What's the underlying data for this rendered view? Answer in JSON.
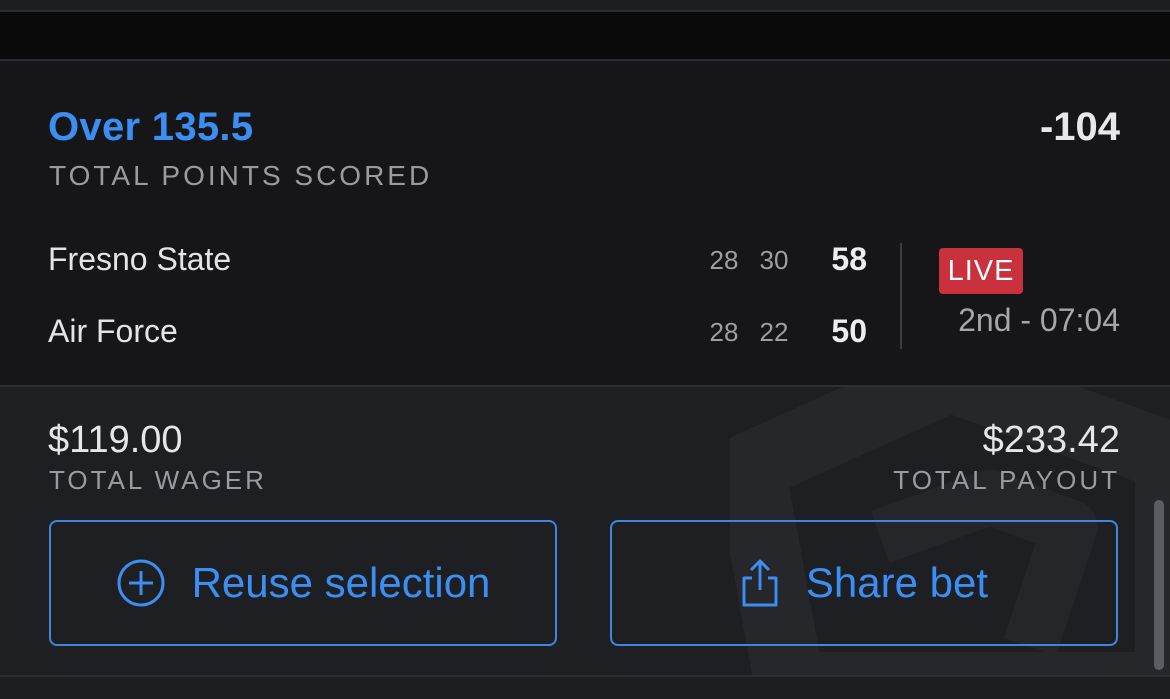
{
  "bet": {
    "title": "Over 135.5",
    "market": "TOTAL POINTS SCORED",
    "odds": "-104"
  },
  "game": {
    "teams": [
      {
        "name": "Fresno State",
        "q1": "28",
        "q2": "30",
        "total": "58"
      },
      {
        "name": "Air Force",
        "q1": "28",
        "q2": "22",
        "total": "50"
      }
    ],
    "status_badge": "LIVE",
    "clock": "2nd - 07:04"
  },
  "summary": {
    "wager_amount": "$119.00",
    "wager_label": "TOTAL WAGER",
    "payout_amount": "$233.42",
    "payout_label": "TOTAL PAYOUT"
  },
  "actions": {
    "reuse_label": "Reuse selection",
    "share_label": "Share bet"
  },
  "colors": {
    "accent": "#3b8ef3",
    "live": "#c9313d",
    "background": "#161619"
  },
  "icons": {
    "reuse": "plus-circle-icon",
    "share": "share-icon",
    "watermark": "brand-logo-watermark"
  }
}
